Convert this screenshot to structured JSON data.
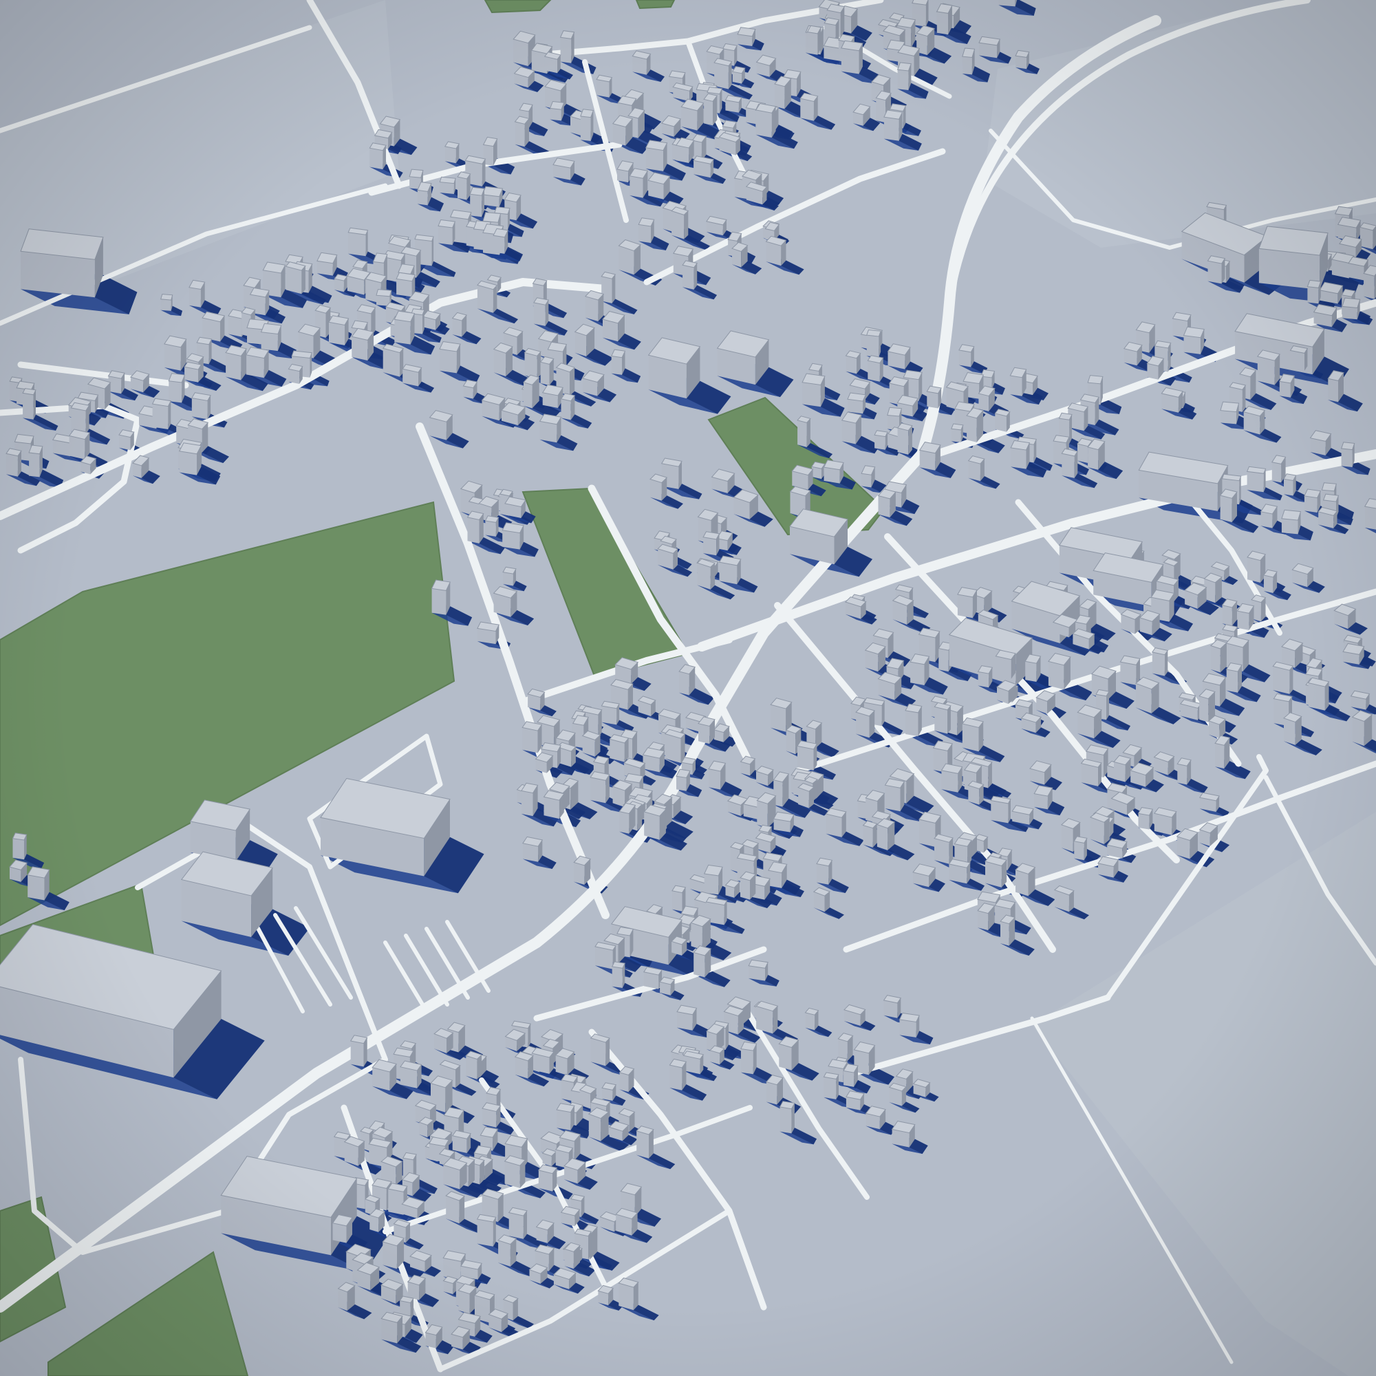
{
  "scene": {
    "kind": "3d-city-model-render",
    "labels": []
  },
  "palette": {
    "ground": "#b4bcc9",
    "ground_light": "#c3cad5",
    "road": "#eef2f4",
    "road_edge": "#dfe6ea",
    "shadow": "#1d3f8f",
    "shadow_dark": "#142d6e",
    "park": "#6d8f64",
    "park_edge": "#5f7f57",
    "building_top": "#c9cfd8",
    "building_side_lit": "#b3bac6",
    "building_side_dark": "#8f97a5"
  },
  "layers": [
    "ground",
    "fields",
    "parks",
    "roads",
    "buildings",
    "shadows"
  ]
}
